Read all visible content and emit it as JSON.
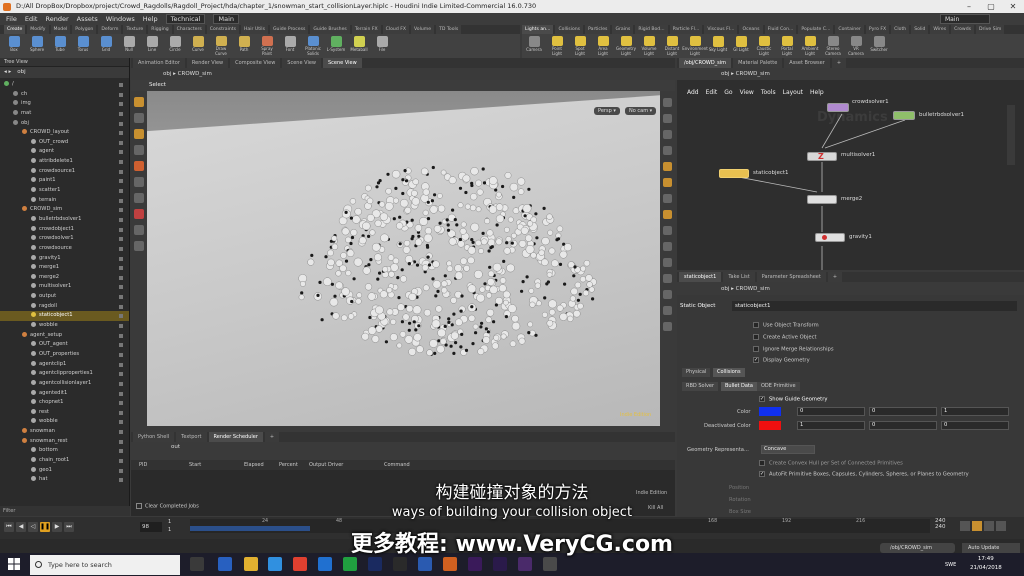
{
  "window": {
    "title": "D:/All DropBox/Dropbox/project/Crowd_Ragdolls/Ragdoll_Project/hda/chapter_1/snowman_start_collisionLayer.hiplc - Houdini Indie Limited-Commercial 16.0.730",
    "controls": [
      "–",
      "▢",
      "✕"
    ]
  },
  "menubar": {
    "items": [
      "File",
      "Edit",
      "Render",
      "Assets",
      "Windows",
      "Help"
    ],
    "desktop": "Technical",
    "build": "Main",
    "right_build": "Main"
  },
  "shelf": {
    "tabs": [
      "Create",
      "Modify",
      "Model",
      "Polygon",
      "Deform",
      "Texture",
      "Rigging",
      "Characters",
      "Constraints",
      "Hair Utils",
      "Guide Process",
      "Guide Brushes",
      "Terrain FX",
      "Cloud FX",
      "Volume",
      "TD Tools"
    ],
    "tools": [
      {
        "label": "Box",
        "color": "#5a8fd0"
      },
      {
        "label": "Sphere",
        "color": "#5a8fd0"
      },
      {
        "label": "Tube",
        "color": "#5a8fd0"
      },
      {
        "label": "Torus",
        "color": "#5a8fd0"
      },
      {
        "label": "Grid",
        "color": "#5a8fd0"
      },
      {
        "label": "Null",
        "color": "#aaaaaa"
      },
      {
        "label": "Line",
        "color": "#aaaaaa"
      },
      {
        "label": "Circle",
        "color": "#aaaaaa"
      },
      {
        "label": "Curve",
        "color": "#d0b050"
      },
      {
        "label": "Draw Curve",
        "color": "#d0b050"
      },
      {
        "label": "Path",
        "color": "#d0b050"
      },
      {
        "label": "Spray Paint",
        "color": "#d07050"
      },
      {
        "label": "Font",
        "color": "#aaaaaa"
      },
      {
        "label": "Platonic Solids",
        "color": "#5a8fd0"
      },
      {
        "label": "L-System",
        "color": "#60b060"
      },
      {
        "label": "Metaball",
        "color": "#d0d050"
      },
      {
        "label": "File",
        "color": "#aaaaaa"
      }
    ],
    "tabs2": [
      "Lights an...",
      "Collisions",
      "Particles",
      "Grains",
      "Rigid Bod...",
      "Particle Fl...",
      "Viscous Fl...",
      "Oceans",
      "Fluid Con...",
      "Populate C...",
      "Container",
      "Pyro FX",
      "Cloth",
      "Solid",
      "Wires",
      "Crowds",
      "Drive Sim"
    ],
    "tools2": [
      {
        "label": "Camera",
        "color": "#888888"
      },
      {
        "label": "Point Light",
        "color": "#e0c040"
      },
      {
        "label": "Spot Light",
        "color": "#e0c040"
      },
      {
        "label": "Area Light",
        "color": "#e0c040"
      },
      {
        "label": "Geometry Light",
        "color": "#e0c040"
      },
      {
        "label": "Volume Light",
        "color": "#e0c040"
      },
      {
        "label": "Distant Light",
        "color": "#e0c040"
      },
      {
        "label": "Environment Light",
        "color": "#e0c040"
      },
      {
        "label": "Sky Light",
        "color": "#e0c040"
      },
      {
        "label": "GI Light",
        "color": "#e0c040"
      },
      {
        "label": "Caustic Light",
        "color": "#e0c040"
      },
      {
        "label": "Portal Light",
        "color": "#e0c040"
      },
      {
        "label": "Ambient Light",
        "color": "#e0c040"
      },
      {
        "label": "Stereo Camera",
        "color": "#888888"
      },
      {
        "label": "VR Camera",
        "color": "#888888"
      },
      {
        "label": "Switcher",
        "color": "#888888"
      }
    ]
  },
  "tree_view": {
    "tab": "Tree View",
    "path": "obj",
    "rows": [
      {
        "label": "/",
        "indent": 0,
        "color": "#60b060"
      },
      {
        "label": "ch",
        "indent": 1,
        "color": "#888888"
      },
      {
        "label": "img",
        "indent": 1,
        "color": "#888888"
      },
      {
        "label": "mat",
        "indent": 1,
        "color": "#888888"
      },
      {
        "label": "obj",
        "indent": 1,
        "color": "#888888"
      },
      {
        "label": "CROWD_layout",
        "indent": 2,
        "color": "#d08040"
      },
      {
        "label": "OUT_crowd",
        "indent": 3,
        "color": "#aaaaaa"
      },
      {
        "label": "agent",
        "indent": 3,
        "color": "#aaaaaa"
      },
      {
        "label": "attribdelete1",
        "indent": 3,
        "color": "#aaaaaa"
      },
      {
        "label": "crowdsource1",
        "indent": 3,
        "color": "#aaaaaa"
      },
      {
        "label": "paint1",
        "indent": 3,
        "color": "#aaaaaa"
      },
      {
        "label": "scatter1",
        "indent": 3,
        "color": "#aaaaaa"
      },
      {
        "label": "terrain",
        "indent": 3,
        "color": "#aaaaaa"
      },
      {
        "label": "CROWD_sim",
        "indent": 2,
        "color": "#d08040"
      },
      {
        "label": "bulletrbdsolver1",
        "indent": 3,
        "color": "#aaaaaa"
      },
      {
        "label": "crowdobject1",
        "indent": 3,
        "color": "#aaaaaa"
      },
      {
        "label": "crowdsolver1",
        "indent": 3,
        "color": "#aaaaaa"
      },
      {
        "label": "crowdsource",
        "indent": 3,
        "color": "#aaaaaa"
      },
      {
        "label": "gravity1",
        "indent": 3,
        "color": "#aaaaaa"
      },
      {
        "label": "merge1",
        "indent": 3,
        "color": "#aaaaaa"
      },
      {
        "label": "merge2",
        "indent": 3,
        "color": "#aaaaaa"
      },
      {
        "label": "multisolver1",
        "indent": 3,
        "color": "#aaaaaa"
      },
      {
        "label": "output",
        "indent": 3,
        "color": "#aaaaaa"
      },
      {
        "label": "ragdoll",
        "indent": 3,
        "color": "#aaaaaa"
      },
      {
        "label": "staticobject1",
        "indent": 3,
        "color": "#e0c040",
        "selected": true
      },
      {
        "label": "wobble",
        "indent": 3,
        "color": "#aaaaaa"
      },
      {
        "label": "agent_setup",
        "indent": 2,
        "color": "#d08040"
      },
      {
        "label": "OUT_agent",
        "indent": 3,
        "color": "#aaaaaa"
      },
      {
        "label": "OUT_properties",
        "indent": 3,
        "color": "#aaaaaa"
      },
      {
        "label": "agentclip1",
        "indent": 3,
        "color": "#aaaaaa"
      },
      {
        "label": "agentclipproperties1",
        "indent": 3,
        "color": "#aaaaaa"
      },
      {
        "label": "agentcollisionlayer1",
        "indent": 3,
        "color": "#aaaaaa"
      },
      {
        "label": "agentedit1",
        "indent": 3,
        "color": "#aaaaaa"
      },
      {
        "label": "chopnet1",
        "indent": 3,
        "color": "#aaaaaa"
      },
      {
        "label": "rest",
        "indent": 3,
        "color": "#aaaaaa"
      },
      {
        "label": "wobble",
        "indent": 3,
        "color": "#aaaaaa"
      },
      {
        "label": "snowman",
        "indent": 2,
        "color": "#d08040"
      },
      {
        "label": "snowman_rest",
        "indent": 2,
        "color": "#d08040"
      },
      {
        "label": "bottom",
        "indent": 3,
        "color": "#aaaaaa"
      },
      {
        "label": "chain_root1",
        "indent": 3,
        "color": "#aaaaaa"
      },
      {
        "label": "geo1",
        "indent": 3,
        "color": "#aaaaaa"
      },
      {
        "label": "hat",
        "indent": 3,
        "color": "#aaaaaa"
      }
    ],
    "filter_label": "Filter"
  },
  "viewer": {
    "tabs": [
      "Animation Editor",
      "Render View",
      "Composite View",
      "Scene View",
      "Scene View"
    ],
    "path_root": "obj",
    "path_node": "CROWD_sim",
    "header": "Select",
    "persp": "Persp ▾",
    "cam": "No cam ▾",
    "watermark": "Indie Edition"
  },
  "python_shell": {
    "tabs": [
      "Python Shell",
      "Textport",
      "Render Scheduler",
      "+"
    ],
    "path": "out",
    "columns": [
      "PID",
      "Start",
      "Elapsed",
      "Percent",
      "Output Driver",
      "Command"
    ],
    "clear_label": "Clear Completed Jobs",
    "watermark": "Indie Edition",
    "kill_label": "Kill All"
  },
  "network": {
    "tabs": [
      "/obj/CROWD_sim",
      "Material Palette",
      "Asset Browser",
      "+"
    ],
    "path_root": "obj",
    "path_node": "CROWD_sim",
    "menu": [
      "Add",
      "Edit",
      "Go",
      "View",
      "Tools",
      "Layout",
      "Help"
    ],
    "watermark": "Dynamics",
    "nodes": {
      "crowdsolver": "crowdsolver1",
      "bullet": "bulletrbdsolver1",
      "multisolver": "multisolver1",
      "static": "staticobject1",
      "merge": "merge2",
      "gravity": "gravity1"
    }
  },
  "params": {
    "tabs": [
      "staticobject1",
      "Take List",
      "Parameter Spreadsheet",
      "+"
    ],
    "path_root": "obj",
    "path_node": "CROWD_sim",
    "node_type": "Static Object",
    "node_name": "staticobject1",
    "checks": [
      {
        "label": "Use Object Transform",
        "checked": false
      },
      {
        "label": "Create Active Object",
        "checked": false
      },
      {
        "label": "Ignore Merge Relationships",
        "checked": false
      },
      {
        "label": "Display Geometry",
        "checked": true
      }
    ],
    "tabs_main": [
      "Physical",
      "Collisions"
    ],
    "tabs_sub": [
      "RBD Solver",
      "Bullet Data",
      "ODE Primitive"
    ],
    "show_guide": "Show Guide Geometry",
    "color_label": "Color",
    "color_vals": [
      "0",
      "0",
      "1"
    ],
    "deact_label": "Deactivated Color",
    "deact_vals": [
      "1",
      "0",
      "0"
    ],
    "geo_rep_label": "Geometry Representa...",
    "geo_rep_value": "Concave",
    "convex_label": "Create Convex Hull per Set of Connected Primitives",
    "autofit_label": "AutoFit Primitive Boxes, Capsules, Cylinders, Spheres, or Planes to Geometry",
    "position_label": "Position",
    "rotation_label": "Rotation",
    "boxsize_label": "Box Size",
    "colors": {
      "color": "#1030f0",
      "deact": "#f01010"
    }
  },
  "timeline": {
    "frame": "98",
    "start": "1",
    "start2": "1",
    "ticks": [
      "24",
      "48",
      "168",
      "192",
      "216"
    ],
    "end_a": "240",
    "end_b": "240",
    "progress": 0.4
  },
  "taskbar": {
    "search_placeholder": "Type here to search",
    "time": "17:49",
    "date": "21/04/2018",
    "lang": "SWE",
    "path_box": "/obj/CROWD_sim",
    "auto_update": "Auto Update"
  },
  "subtitles": {
    "chinese": "构建碰撞对象的方法",
    "english": "ways of building your collision object",
    "promo_prefix": "更多教程:",
    "promo_url": "www.VeryCG.com"
  }
}
